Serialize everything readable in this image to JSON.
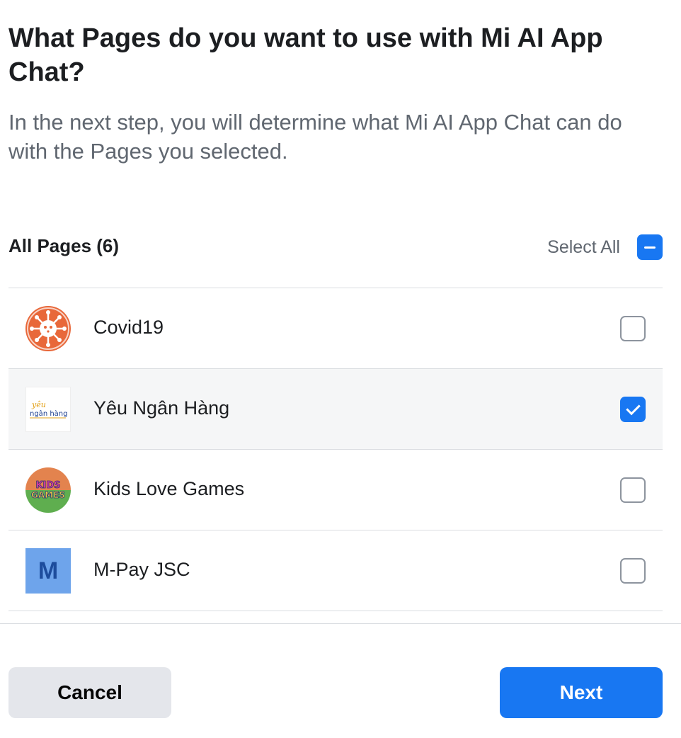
{
  "dialog": {
    "title": "What Pages do you want to use with Mi AI App Chat?",
    "subtitle": "In the next step, you will determine what Mi AI App Chat can do with the Pages you selected."
  },
  "list_header": {
    "title": "All Pages (6)",
    "select_all_label": "Select All",
    "select_all_state": "mixed"
  },
  "pages": [
    {
      "name": "Covid19",
      "avatar": "covid-virus-icon",
      "checked": false
    },
    {
      "name": "Yêu Ngân Hàng",
      "avatar": "yeu-ngan-hang-logo",
      "logo_text_top": "yêu",
      "logo_text_bottom": "ngân hàng",
      "checked": true
    },
    {
      "name": "Kids Love Games",
      "avatar": "kids-games-logo",
      "logo_text_top": "KIDS",
      "logo_text_bottom": "GAMES",
      "checked": false
    },
    {
      "name": "M-Pay JSC",
      "avatar": "m-letter-avatar",
      "logo_letter": "M",
      "checked": false
    }
  ],
  "footer": {
    "cancel_label": "Cancel",
    "next_label": "Next"
  },
  "colors": {
    "primary": "#1877f2",
    "text_primary": "#1c1e21",
    "text_secondary": "#606770",
    "divider": "#dadde1",
    "selected_row_bg": "#f5f6f7"
  }
}
